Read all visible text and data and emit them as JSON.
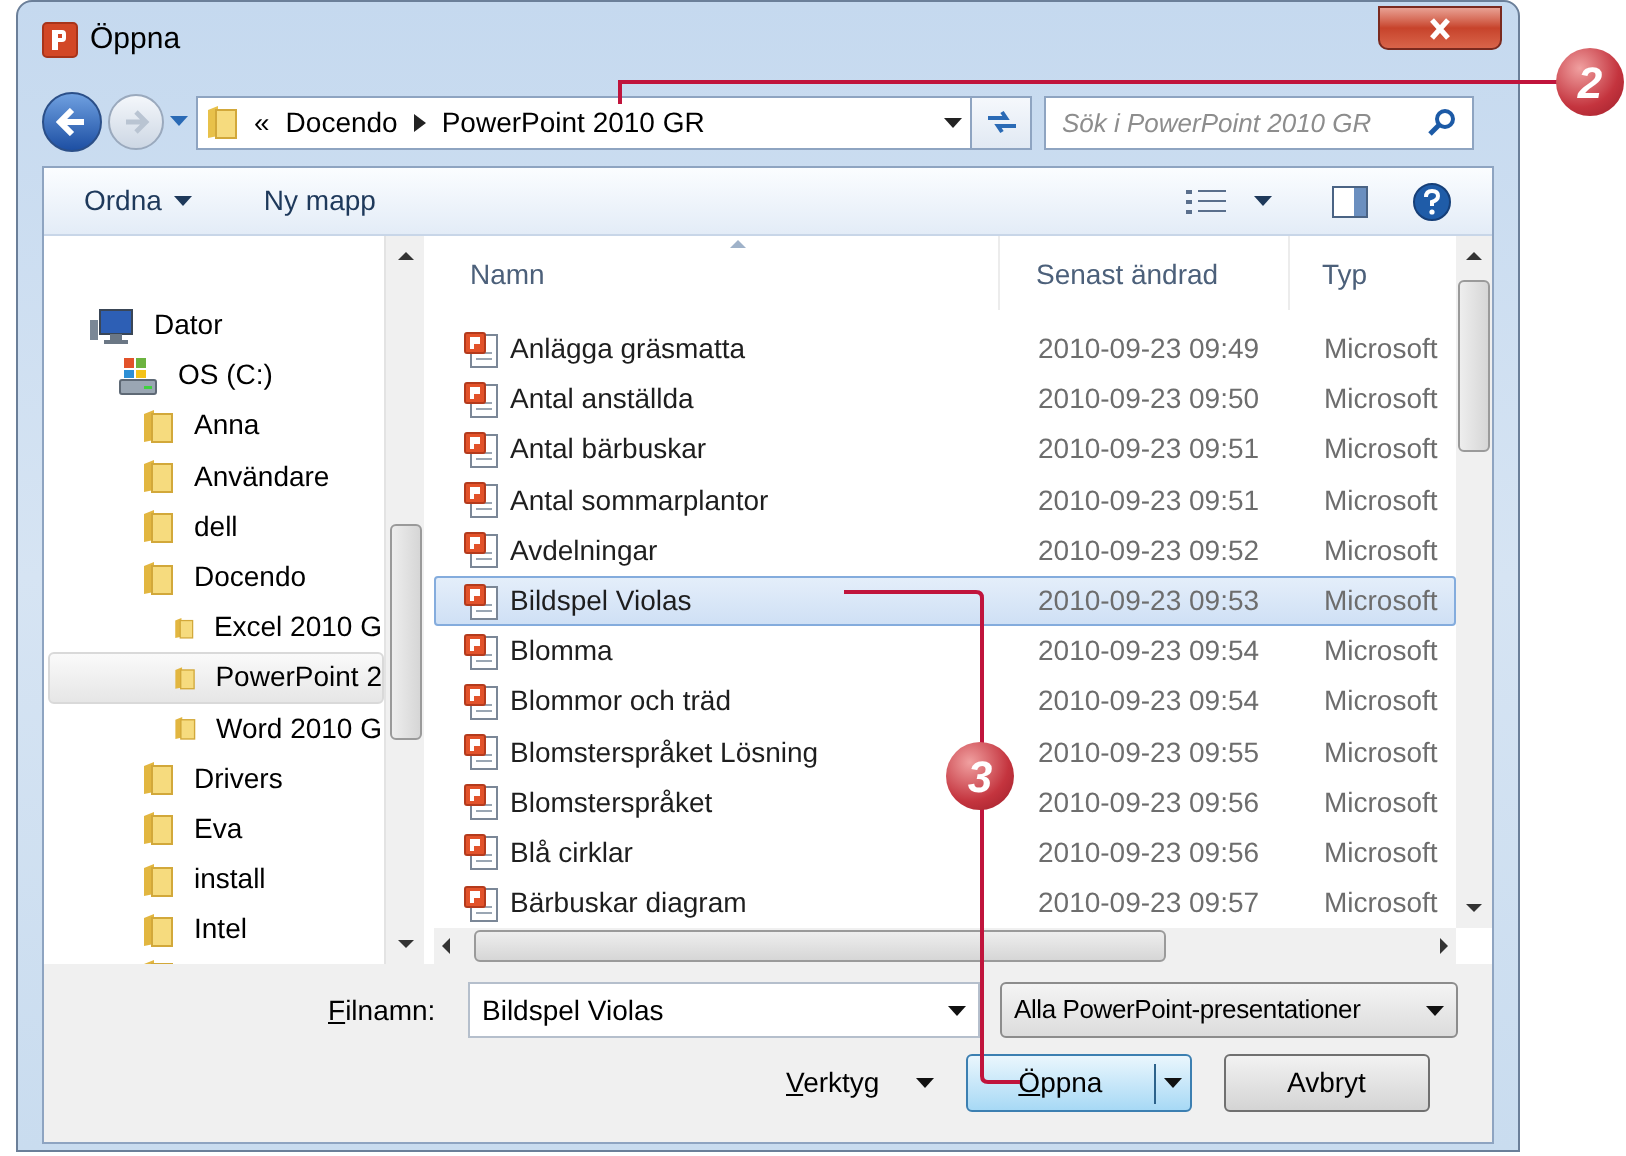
{
  "window": {
    "title": "Öppna"
  },
  "address": {
    "crumbs": [
      "«",
      "Docendo",
      "PowerPoint 2010 GR"
    ]
  },
  "search": {
    "placeholder": "Sök i PowerPoint 2010 GR"
  },
  "toolbar": {
    "organize": "Ordna",
    "new_folder": "Ny mapp"
  },
  "tree": [
    {
      "label": "Dator",
      "kind": "computer",
      "selected": false,
      "children": [
        {
          "label": "OS (C:)",
          "kind": "drive",
          "selected": false,
          "children": [
            {
              "label": "Anna",
              "kind": "folder",
              "selected": false
            },
            {
              "label": "Användare",
              "kind": "folder",
              "selected": false
            },
            {
              "label": "dell",
              "kind": "folder",
              "selected": false
            },
            {
              "label": "Docendo",
              "kind": "folder",
              "selected": false,
              "children": [
                {
                  "label": "Excel 2010 G",
                  "kind": "folder",
                  "selected": false
                },
                {
                  "label": "PowerPoint 2",
                  "kind": "folder",
                  "selected": true
                },
                {
                  "label": "Word 2010 G",
                  "kind": "folder",
                  "selected": false
                }
              ]
            },
            {
              "label": "Drivers",
              "kind": "folder",
              "selected": false
            },
            {
              "label": "Eva",
              "kind": "folder",
              "selected": false
            },
            {
              "label": "install",
              "kind": "folder",
              "selected": false
            },
            {
              "label": "Intel",
              "kind": "folder",
              "selected": false
            },
            {
              "kind": "folder",
              "selected": false
            }
          ]
        }
      ]
    }
  ],
  "columns": [
    "Namn",
    "Senast ändrad",
    "Typ"
  ],
  "files": [
    {
      "name": "Anlägga gräsmatta",
      "modified": "2010-09-23 09:49",
      "type": "Microsoft",
      "selected": false
    },
    {
      "name": "Antal anställda",
      "modified": "2010-09-23 09:50",
      "type": "Microsoft",
      "selected": false
    },
    {
      "name": "Antal bärbuskar",
      "modified": "2010-09-23 09:51",
      "type": "Microsoft",
      "selected": false
    },
    {
      "name": "Antal sommarplantor",
      "modified": "2010-09-23 09:51",
      "type": "Microsoft",
      "selected": false
    },
    {
      "name": "Avdelningar",
      "modified": "2010-09-23 09:52",
      "type": "Microsoft",
      "selected": false
    },
    {
      "name": "Bildspel Violas",
      "modified": "2010-09-23 09:53",
      "type": "Microsoft",
      "selected": true
    },
    {
      "name": "Blomma",
      "modified": "2010-09-23 09:54",
      "type": "Microsoft",
      "selected": false
    },
    {
      "name": "Blommor och träd",
      "modified": "2010-09-23 09:54",
      "type": "Microsoft",
      "selected": false
    },
    {
      "name": "Blomsterspråket Lösning",
      "modified": "2010-09-23 09:55",
      "type": "Microsoft",
      "selected": false
    },
    {
      "name": "Blomsterspråket",
      "modified": "2010-09-23 09:56",
      "type": "Microsoft",
      "selected": false
    },
    {
      "name": "Blå cirklar",
      "modified": "2010-09-23 09:56",
      "type": "Microsoft",
      "selected": false
    },
    {
      "name": "Bärbuskar diagram",
      "modified": "2010-09-23 09:57",
      "type": "Microsoft",
      "selected": false
    }
  ],
  "filename": {
    "label": "Filnamn:",
    "value": "Bildspel Violas"
  },
  "file_type": "Alla PowerPoint-presentationer",
  "buttons": {
    "tools": "Verktyg",
    "open": "Öppna",
    "cancel": "Avbryt"
  },
  "callouts": [
    "2",
    "3"
  ]
}
